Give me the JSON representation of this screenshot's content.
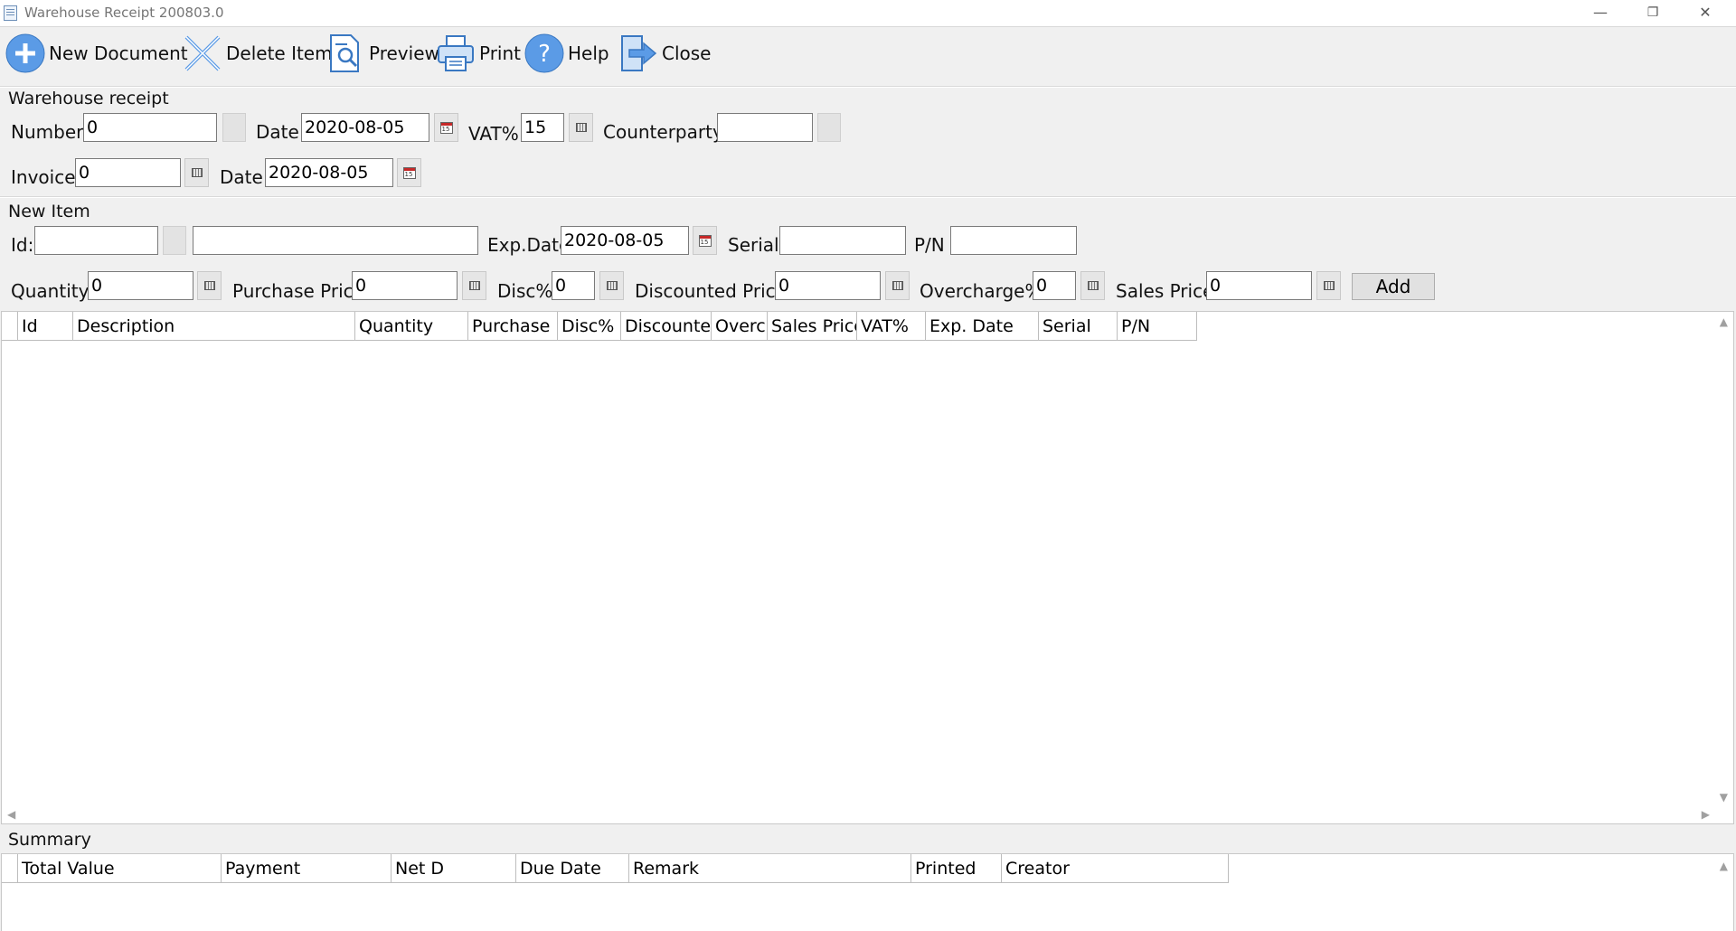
{
  "window": {
    "title": "Warehouse Receipt 200803.0",
    "controls": {
      "minimize": "—",
      "restore": "❐",
      "close": "✕"
    }
  },
  "toolbar": {
    "new_document": "New Document",
    "delete_item": "Delete Item",
    "preview": "Preview",
    "print": "Print",
    "help": "Help",
    "close": "Close"
  },
  "receipt": {
    "group_title": "Warehouse receipt",
    "number_label": "Number:",
    "number_value": "0",
    "date_label": "Date:",
    "date_value": "2020-08-05",
    "vat_label": "VAT%:",
    "vat_value": "15",
    "counterparty_label": "Counterparty:",
    "counterparty_value": "",
    "invoice_label": "Invoice:",
    "invoice_value": "0",
    "invoice_date_label": "Date:",
    "invoice_date_value": "2020-08-05"
  },
  "new_item": {
    "group_title": "New Item",
    "id_label": "Id:",
    "id_value": "",
    "description_value": "",
    "exp_date_label": "Exp.Date",
    "exp_date_value": "2020-08-05",
    "serial_label": "Serial:",
    "serial_value": "",
    "pn_label": "P/N",
    "pn_value": "",
    "quantity_label": "Quantity:",
    "quantity_value": "0",
    "purchase_price_label": "Purchase Price:",
    "purchase_price_value": "0",
    "disc_label": "Disc%:",
    "disc_value": "0",
    "discounted_price_label": "Discounted Price:",
    "discounted_price_value": "0",
    "overcharge_label": "Overcharge%:",
    "overcharge_value": "0",
    "sales_price_label": "Sales Price:",
    "sales_price_value": "0",
    "add_label": "Add"
  },
  "items_table": {
    "columns": [
      "Id",
      "Description",
      "Quantity",
      "Purchase P",
      "Disc%",
      "Discountec",
      "Overcl",
      "Sales Price",
      "VAT%",
      "Exp. Date",
      "Serial",
      "P/N"
    ],
    "rows": []
  },
  "summary": {
    "group_title": "Summary",
    "columns": [
      "Total Value",
      "Payment",
      "Net D",
      "Due Date",
      "Remark",
      "Printed",
      "Creator"
    ],
    "rows": []
  },
  "colors": {
    "window_bg": "#f0f0f0",
    "icon_blue": "#4a90e2",
    "calendar_red": "#c62828"
  },
  "icons": [
    "plus-circle-icon",
    "cross-icon",
    "preview-icon",
    "printer-icon",
    "help-icon",
    "exit-arrow-icon",
    "calculator-icon",
    "calendar-icon"
  ]
}
